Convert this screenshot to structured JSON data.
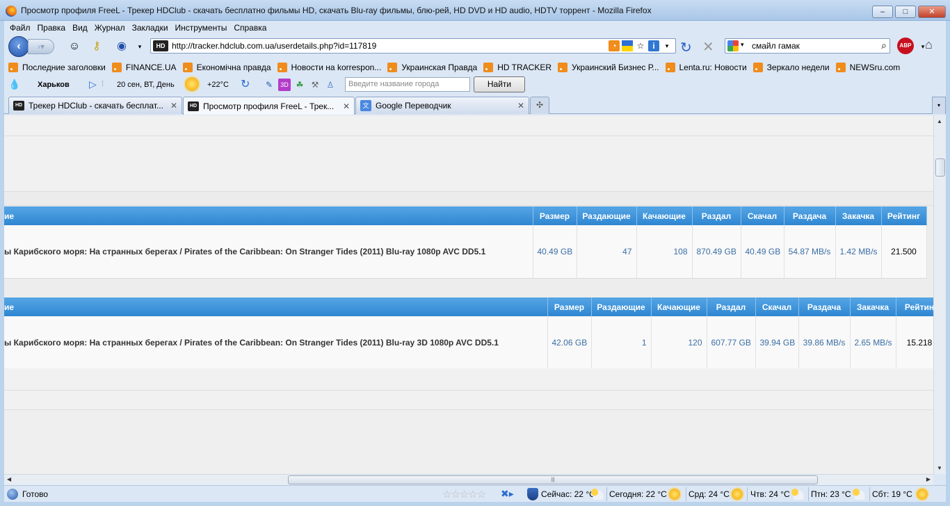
{
  "window": {
    "title": "Просмотр профиля FreeL - Трекер HDClub - скачать бесплатно фильмы HD, скачать Blu-ray фильмы, блю-рей, HD DVD и HD audio, HDTV торрент - Mozilla Firefox",
    "buttons": {
      "minimize": "–",
      "maximize": "□",
      "close": "✕"
    }
  },
  "menu": [
    "Файл",
    "Правка",
    "Вид",
    "Журнал",
    "Закладки",
    "Инструменты",
    "Справка"
  ],
  "nav": {
    "url": "http://tracker.hdclub.com.ua/userdetails.php?id=117819",
    "site_icon": "HD",
    "search_query": "смайл гамак",
    "abp_label": "ABP"
  },
  "bookmarks": [
    "Последние заголовки",
    "FINANCE.UA",
    "Економічна правда",
    "Новости на korrespon...",
    "Украинская Правда",
    "HD TRACKER",
    "Украинский Бизнес Р...",
    "Lenta.ru: Новости",
    "Зеркало недели",
    "NEWSru.com"
  ],
  "weather_bar": {
    "city": "Харьков",
    "date": "20 сен, ВТ, День",
    "temp": "+22°C",
    "city_placeholder": "Введите название города",
    "find_button": "Найти"
  },
  "tabs": [
    {
      "label": "Трекер HDClub - скачать бесплат...",
      "icon": "hd-icon"
    },
    {
      "label": "Просмотр профиля FreeL - Трек...",
      "icon": "hd-icon",
      "active": true
    },
    {
      "label": "Google Переводчик",
      "icon": "google-translate-icon"
    }
  ],
  "tables": [
    {
      "headers": [
        "ие",
        "Размер",
        "Раздающие",
        "Качающие",
        "Раздал",
        "Скачал",
        "Раздача",
        "Закачка",
        "Рейтинг"
      ],
      "row": [
        "ы Карибского моря: На странных берегах / Pirates of the Caribbean: On Stranger Tides (2011) Blu-ray 1080p AVC DD5.1",
        "40.49 GB",
        "47",
        "108",
        "870.49 GB",
        "40.49 GB",
        "54.87 MB/s",
        "1.42 MB/s",
        "21.500"
      ]
    },
    {
      "headers": [
        "ие",
        "Размер",
        "Раздающие",
        "Качающие",
        "Раздал",
        "Скачал",
        "Раздача",
        "Закачка",
        "Рейтин"
      ],
      "row": [
        "ы Карибского моря: На странных берегах / Pirates of the Caribbean: On Stranger Tides (2011) Blu-ray 3D 1080p AVC DD5.1",
        "42.06 GB",
        "1",
        "120",
        "607.77 GB",
        "39.94 GB",
        "39.86 MB/s",
        "2.65 MB/s",
        "15.218"
      ]
    }
  ],
  "status": {
    "text": "Готово",
    "now": "Сейчас: 22 °C",
    "today": "Сегодня: 22 °C",
    "wed": "Срд: 24 °C",
    "thu": "Чтв: 24 °C",
    "fri": "Птн: 23 °C",
    "sat": "Сбт: 19 °C"
  },
  "colors": {
    "table_header": "#3f93da",
    "link_value": "#3a6ea5",
    "chrome": "#dce7f5"
  }
}
